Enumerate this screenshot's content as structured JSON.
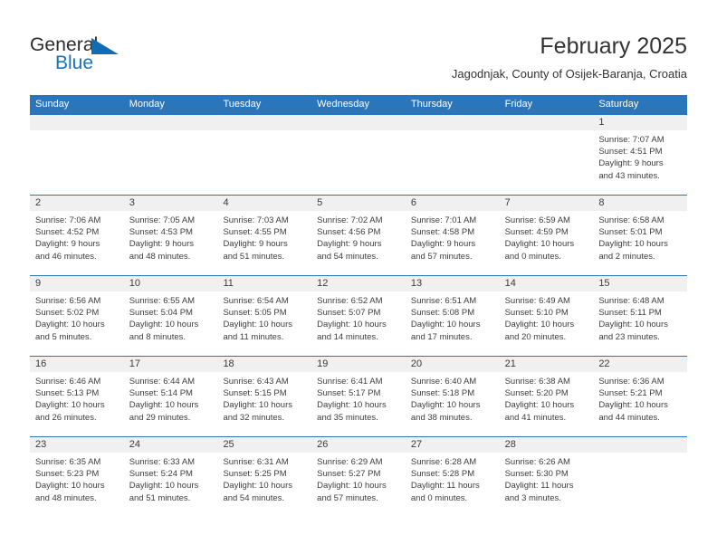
{
  "brand": {
    "word_one": "General",
    "word_two": "Blue",
    "triangle_icon": "triangle-icon",
    "accent_color": "#1773bd"
  },
  "header": {
    "title": "February 2025",
    "subtitle": "Jagodnjak, County of Osijek-Baranja, Croatia"
  },
  "theme": {
    "header_row_bg": "#2b76bb",
    "day_band_bg": "#f0f0f0",
    "row_border": "#2b76bb",
    "text_color": "#3d3d3d"
  },
  "calendar": {
    "weekday_headers": [
      "Sunday",
      "Monday",
      "Tuesday",
      "Wednesday",
      "Thursday",
      "Friday",
      "Saturday"
    ],
    "weeks": [
      [
        {
          "day": "",
          "empty": true
        },
        {
          "day": "",
          "empty": true
        },
        {
          "day": "",
          "empty": true
        },
        {
          "day": "",
          "empty": true
        },
        {
          "day": "",
          "empty": true
        },
        {
          "day": "",
          "empty": true
        },
        {
          "day": "1",
          "sunrise": "Sunrise: 7:07 AM",
          "sunset": "Sunset: 4:51 PM",
          "daylight_1": "Daylight: 9 hours",
          "daylight_2": "and 43 minutes."
        }
      ],
      [
        {
          "day": "2",
          "sunrise": "Sunrise: 7:06 AM",
          "sunset": "Sunset: 4:52 PM",
          "daylight_1": "Daylight: 9 hours",
          "daylight_2": "and 46 minutes."
        },
        {
          "day": "3",
          "sunrise": "Sunrise: 7:05 AM",
          "sunset": "Sunset: 4:53 PM",
          "daylight_1": "Daylight: 9 hours",
          "daylight_2": "and 48 minutes."
        },
        {
          "day": "4",
          "sunrise": "Sunrise: 7:03 AM",
          "sunset": "Sunset: 4:55 PM",
          "daylight_1": "Daylight: 9 hours",
          "daylight_2": "and 51 minutes."
        },
        {
          "day": "5",
          "sunrise": "Sunrise: 7:02 AM",
          "sunset": "Sunset: 4:56 PM",
          "daylight_1": "Daylight: 9 hours",
          "daylight_2": "and 54 minutes."
        },
        {
          "day": "6",
          "sunrise": "Sunrise: 7:01 AM",
          "sunset": "Sunset: 4:58 PM",
          "daylight_1": "Daylight: 9 hours",
          "daylight_2": "and 57 minutes."
        },
        {
          "day": "7",
          "sunrise": "Sunrise: 6:59 AM",
          "sunset": "Sunset: 4:59 PM",
          "daylight_1": "Daylight: 10 hours",
          "daylight_2": "and 0 minutes."
        },
        {
          "day": "8",
          "sunrise": "Sunrise: 6:58 AM",
          "sunset": "Sunset: 5:01 PM",
          "daylight_1": "Daylight: 10 hours",
          "daylight_2": "and 2 minutes."
        }
      ],
      [
        {
          "day": "9",
          "sunrise": "Sunrise: 6:56 AM",
          "sunset": "Sunset: 5:02 PM",
          "daylight_1": "Daylight: 10 hours",
          "daylight_2": "and 5 minutes."
        },
        {
          "day": "10",
          "sunrise": "Sunrise: 6:55 AM",
          "sunset": "Sunset: 5:04 PM",
          "daylight_1": "Daylight: 10 hours",
          "daylight_2": "and 8 minutes."
        },
        {
          "day": "11",
          "sunrise": "Sunrise: 6:54 AM",
          "sunset": "Sunset: 5:05 PM",
          "daylight_1": "Daylight: 10 hours",
          "daylight_2": "and 11 minutes."
        },
        {
          "day": "12",
          "sunrise": "Sunrise: 6:52 AM",
          "sunset": "Sunset: 5:07 PM",
          "daylight_1": "Daylight: 10 hours",
          "daylight_2": "and 14 minutes."
        },
        {
          "day": "13",
          "sunrise": "Sunrise: 6:51 AM",
          "sunset": "Sunset: 5:08 PM",
          "daylight_1": "Daylight: 10 hours",
          "daylight_2": "and 17 minutes."
        },
        {
          "day": "14",
          "sunrise": "Sunrise: 6:49 AM",
          "sunset": "Sunset: 5:10 PM",
          "daylight_1": "Daylight: 10 hours",
          "daylight_2": "and 20 minutes."
        },
        {
          "day": "15",
          "sunrise": "Sunrise: 6:48 AM",
          "sunset": "Sunset: 5:11 PM",
          "daylight_1": "Daylight: 10 hours",
          "daylight_2": "and 23 minutes."
        }
      ],
      [
        {
          "day": "16",
          "sunrise": "Sunrise: 6:46 AM",
          "sunset": "Sunset: 5:13 PM",
          "daylight_1": "Daylight: 10 hours",
          "daylight_2": "and 26 minutes."
        },
        {
          "day": "17",
          "sunrise": "Sunrise: 6:44 AM",
          "sunset": "Sunset: 5:14 PM",
          "daylight_1": "Daylight: 10 hours",
          "daylight_2": "and 29 minutes."
        },
        {
          "day": "18",
          "sunrise": "Sunrise: 6:43 AM",
          "sunset": "Sunset: 5:15 PM",
          "daylight_1": "Daylight: 10 hours",
          "daylight_2": "and 32 minutes."
        },
        {
          "day": "19",
          "sunrise": "Sunrise: 6:41 AM",
          "sunset": "Sunset: 5:17 PM",
          "daylight_1": "Daylight: 10 hours",
          "daylight_2": "and 35 minutes."
        },
        {
          "day": "20",
          "sunrise": "Sunrise: 6:40 AM",
          "sunset": "Sunset: 5:18 PM",
          "daylight_1": "Daylight: 10 hours",
          "daylight_2": "and 38 minutes."
        },
        {
          "day": "21",
          "sunrise": "Sunrise: 6:38 AM",
          "sunset": "Sunset: 5:20 PM",
          "daylight_1": "Daylight: 10 hours",
          "daylight_2": "and 41 minutes."
        },
        {
          "day": "22",
          "sunrise": "Sunrise: 6:36 AM",
          "sunset": "Sunset: 5:21 PM",
          "daylight_1": "Daylight: 10 hours",
          "daylight_2": "and 44 minutes."
        }
      ],
      [
        {
          "day": "23",
          "sunrise": "Sunrise: 6:35 AM",
          "sunset": "Sunset: 5:23 PM",
          "daylight_1": "Daylight: 10 hours",
          "daylight_2": "and 48 minutes."
        },
        {
          "day": "24",
          "sunrise": "Sunrise: 6:33 AM",
          "sunset": "Sunset: 5:24 PM",
          "daylight_1": "Daylight: 10 hours",
          "daylight_2": "and 51 minutes."
        },
        {
          "day": "25",
          "sunrise": "Sunrise: 6:31 AM",
          "sunset": "Sunset: 5:25 PM",
          "daylight_1": "Daylight: 10 hours",
          "daylight_2": "and 54 minutes."
        },
        {
          "day": "26",
          "sunrise": "Sunrise: 6:29 AM",
          "sunset": "Sunset: 5:27 PM",
          "daylight_1": "Daylight: 10 hours",
          "daylight_2": "and 57 minutes."
        },
        {
          "day": "27",
          "sunrise": "Sunrise: 6:28 AM",
          "sunset": "Sunset: 5:28 PM",
          "daylight_1": "Daylight: 11 hours",
          "daylight_2": "and 0 minutes."
        },
        {
          "day": "28",
          "sunrise": "Sunrise: 6:26 AM",
          "sunset": "Sunset: 5:30 PM",
          "daylight_1": "Daylight: 11 hours",
          "daylight_2": "and 3 minutes."
        },
        {
          "day": "",
          "empty": true
        }
      ]
    ]
  }
}
